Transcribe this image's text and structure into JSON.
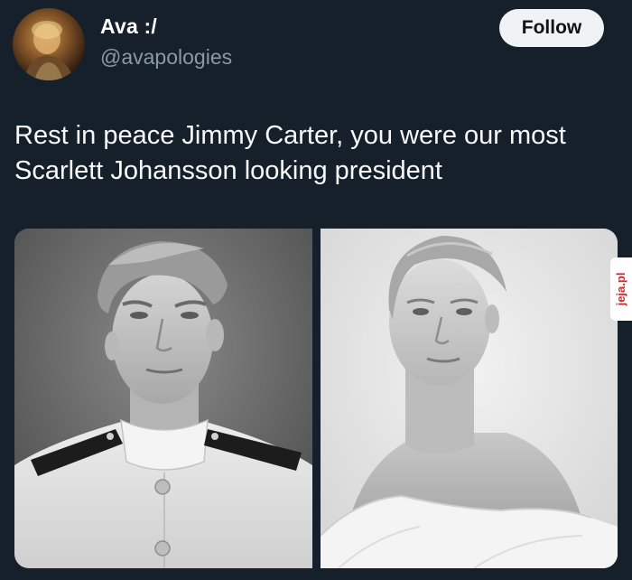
{
  "tweet": {
    "author": {
      "display_name": "Ava :/",
      "handle": "@avapologies"
    },
    "follow_label": "Follow",
    "text": "Rest in peace Jimmy Carter, you were our most\nScarlett Johansson looking president",
    "media": [
      {
        "subject": "black-and-white portrait, young man in white naval uniform"
      },
      {
        "subject": "black-and-white portrait, woman in off-shoulder white top"
      }
    ]
  },
  "watermark": {
    "text": "jeja.pl"
  },
  "colors": {
    "background": "#15202b",
    "text_primary": "#f7f9f9",
    "text_secondary": "#8b98a5",
    "follow_bg": "#eff3f4",
    "follow_text": "#0f1419",
    "watermark_text": "#d6262b"
  }
}
